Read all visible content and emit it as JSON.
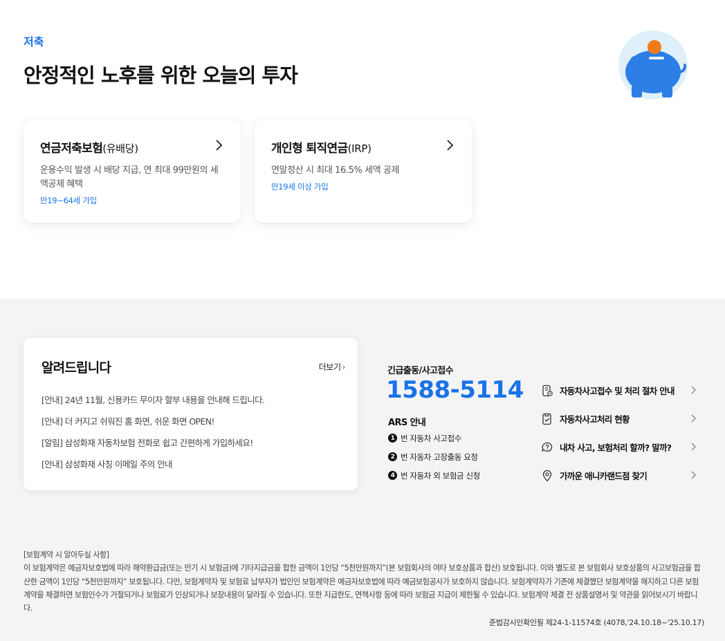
{
  "hero": {
    "eyebrow": "저축",
    "headline": "안정적인 노후를 위한 오늘의 투자"
  },
  "colors": {
    "accent": "#1a73e8",
    "pig": "#2d7ee6",
    "pig_bg": "#dff0fa",
    "coin": "#f07b1a"
  },
  "cards": [
    {
      "title": "연금저축보험",
      "title_sub": "(유배당)",
      "desc": "운용수익 발생 시 배당 지급, 연 최대 99만원의 세액공제 혜택",
      "age": "만19~64세 가입"
    },
    {
      "title": "개인형 퇴직연금",
      "title_sub": "(IRP)",
      "desc": "연말정산 시 최대 16.5% 세액 공제",
      "age": "만19세 이상 가입"
    }
  ],
  "notice": {
    "title": "알려드립니다",
    "more": "더보기",
    "items": [
      "[안내] 24년 11월, 신용카드 무이자 할부 내용을 안내해 드립니다.",
      "[안내] 더 커지고 쉬워진 홈 화면, 쉬운 화면 OPEN!",
      "[알림] 삼성화재 자동차보험 전화로 쉽고 간편하게 가입하세요!",
      "[안내] 삼성화재 사칭 이메일 주의 안내"
    ]
  },
  "emergency": {
    "label": "긴급출동/사고접수",
    "phone": "1588-5114",
    "ars_label": "ARS 안내",
    "ars": [
      {
        "num": "1",
        "text": "번 자동차 사고접수"
      },
      {
        "num": "2",
        "text": "번 자동차 고장출동 요청"
      },
      {
        "num": "4",
        "text": "번 자동차 외 보험금 신청"
      }
    ]
  },
  "quick_links": [
    {
      "label": "자동차사고접수 및 처리 절차 안내",
      "icon": "phone-doc-icon"
    },
    {
      "label": "자동차사고처리 현황",
      "icon": "doc-status-icon"
    },
    {
      "label": "내차 사고, 보험처리 할까? 말까?",
      "icon": "chat-question-icon"
    },
    {
      "label": "가까운 애니카랜드점 찾기",
      "icon": "location-pin-icon"
    }
  ],
  "legal": {
    "title": "[보험계약 시 알아두실 사항]",
    "body": "이 보험계약은 예금자보호법에 따라 해약환급금(또는 만기 시 보험금)에 기타지급금을 합한 금액이 1인당 “5천만원까지”(본 보험회사의 여타 보호상품과 합산) 보호됩니다. 이와 별도로 본 보험회사 보호상품의 사고보험금을 합산한 금액이 1인당 “5천만원까지” 보호됩니다. 다만, 보험계약자 및 보험료 납부자가 법인인 보험계약은 예금자보호법에 따라 예금보험공사가 보호하지 않습니다. 보험계약자가 기존에 체결했던 보험계약을 해지하고 다른 보험계약을 체결하면 보험인수가 거절되거나 보험료가 인상되거나 보장내용이 달라질 수 있습니다. 또한 지급한도, 면책사항 등에 따라 보험금 지급이 제한될 수 있습니다. 보험계약 체결 전 상품설명서 및 약관을 읽어보시기 바랍니다.",
    "approval": "준법감시인확인필 제24-1-11574호 (4078,'24.10.18~'25.10.17)"
  }
}
